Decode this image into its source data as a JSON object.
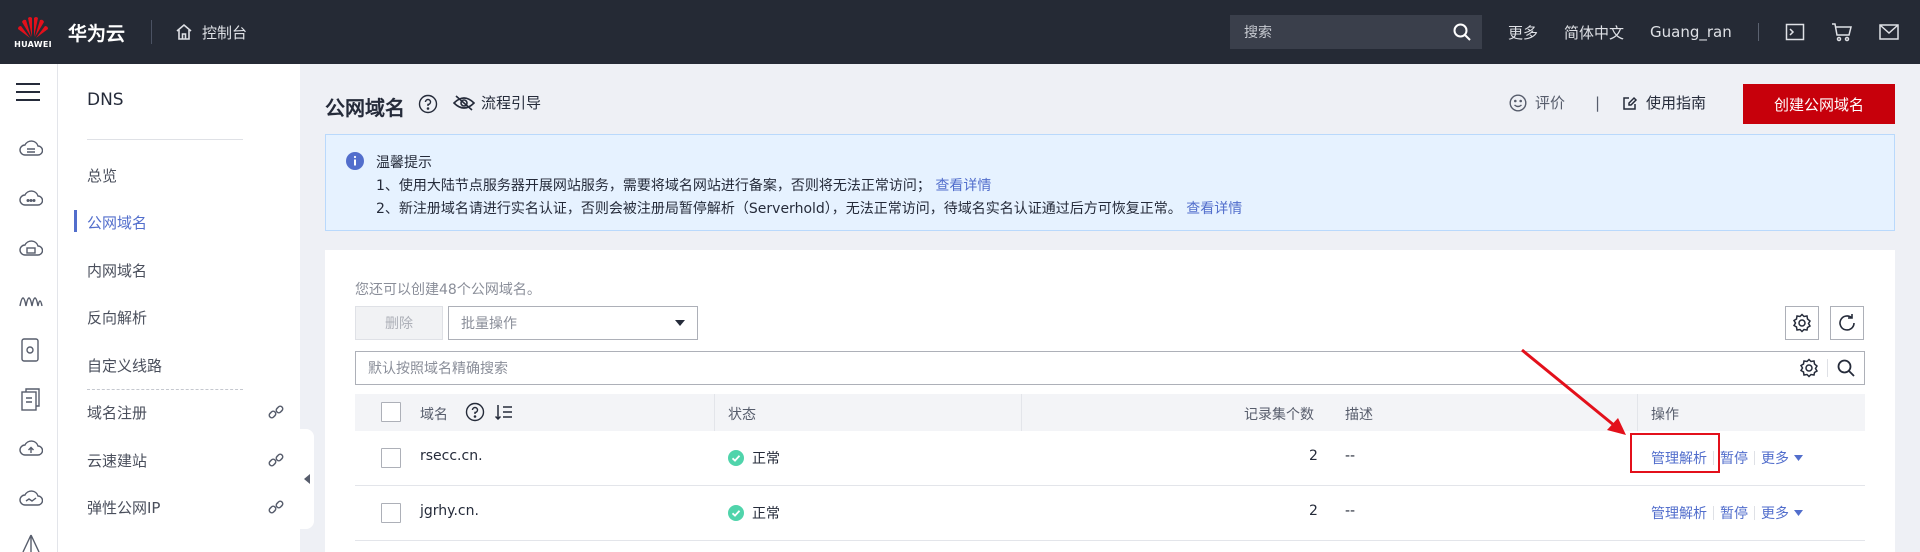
{
  "topbar": {
    "logo_text": "HUAWEI",
    "brand": "华为云",
    "console": "控制台",
    "search_placeholder": "搜索",
    "more": "更多",
    "language": "简体中文",
    "username": "Guang_ran"
  },
  "secondary_nav": {
    "title": "DNS",
    "items": [
      {
        "label": "总览",
        "active": false
      },
      {
        "label": "公网域名",
        "active": true
      },
      {
        "label": "内网域名",
        "active": false
      },
      {
        "label": "反向解析",
        "active": false
      },
      {
        "label": "自定义线路",
        "active": false
      },
      {
        "label": "域名注册",
        "active": false,
        "external": true
      },
      {
        "label": "云速建站",
        "active": false,
        "external": true
      },
      {
        "label": "弹性公网IP",
        "active": false,
        "external": true
      }
    ]
  },
  "header": {
    "title": "公网域名",
    "guide": "流程引导",
    "rate": "评价",
    "separator": "|",
    "manual": "使用指南",
    "create_button": "创建公网域名"
  },
  "notice": {
    "title": "温馨提示",
    "line1": "1、使用大陆节点服务器开展网站服务，需要将域名网站进行备案，否则将无法正常访问；",
    "line1_link": "查看详情",
    "line2": "2、新注册域名请进行实名认证，否则会被注册局暂停解析（Serverhold），无法正常访问，待域名实名认证通过后方可恢复正常。",
    "line2_link": "查看详情"
  },
  "toolbar": {
    "quota": "您还可以创建48个公网域名。",
    "delete": "删除",
    "batch_placeholder": "批量操作",
    "search_placeholder": "默认按照域名精确搜索"
  },
  "table": {
    "columns": {
      "domain": "域名",
      "status": "状态",
      "record_count": "记录集个数",
      "description": "描述",
      "actions": "操作"
    },
    "rows": [
      {
        "domain": "rsecc.cn.",
        "status": "正常",
        "record_count": "2",
        "description": "--",
        "manage": "管理解析",
        "pause": "暂停",
        "more": "更多"
      },
      {
        "domain": "jgrhy.cn.",
        "status": "正常",
        "record_count": "2",
        "description": "--",
        "manage": "管理解析",
        "pause": "暂停",
        "more": "更多"
      }
    ]
  },
  "colors": {
    "topbar_bg": "#252a35",
    "accent": "#526ecc",
    "primary_button": "#c7000b",
    "success": "#50d4ab",
    "annotation_red": "#e3101b"
  }
}
